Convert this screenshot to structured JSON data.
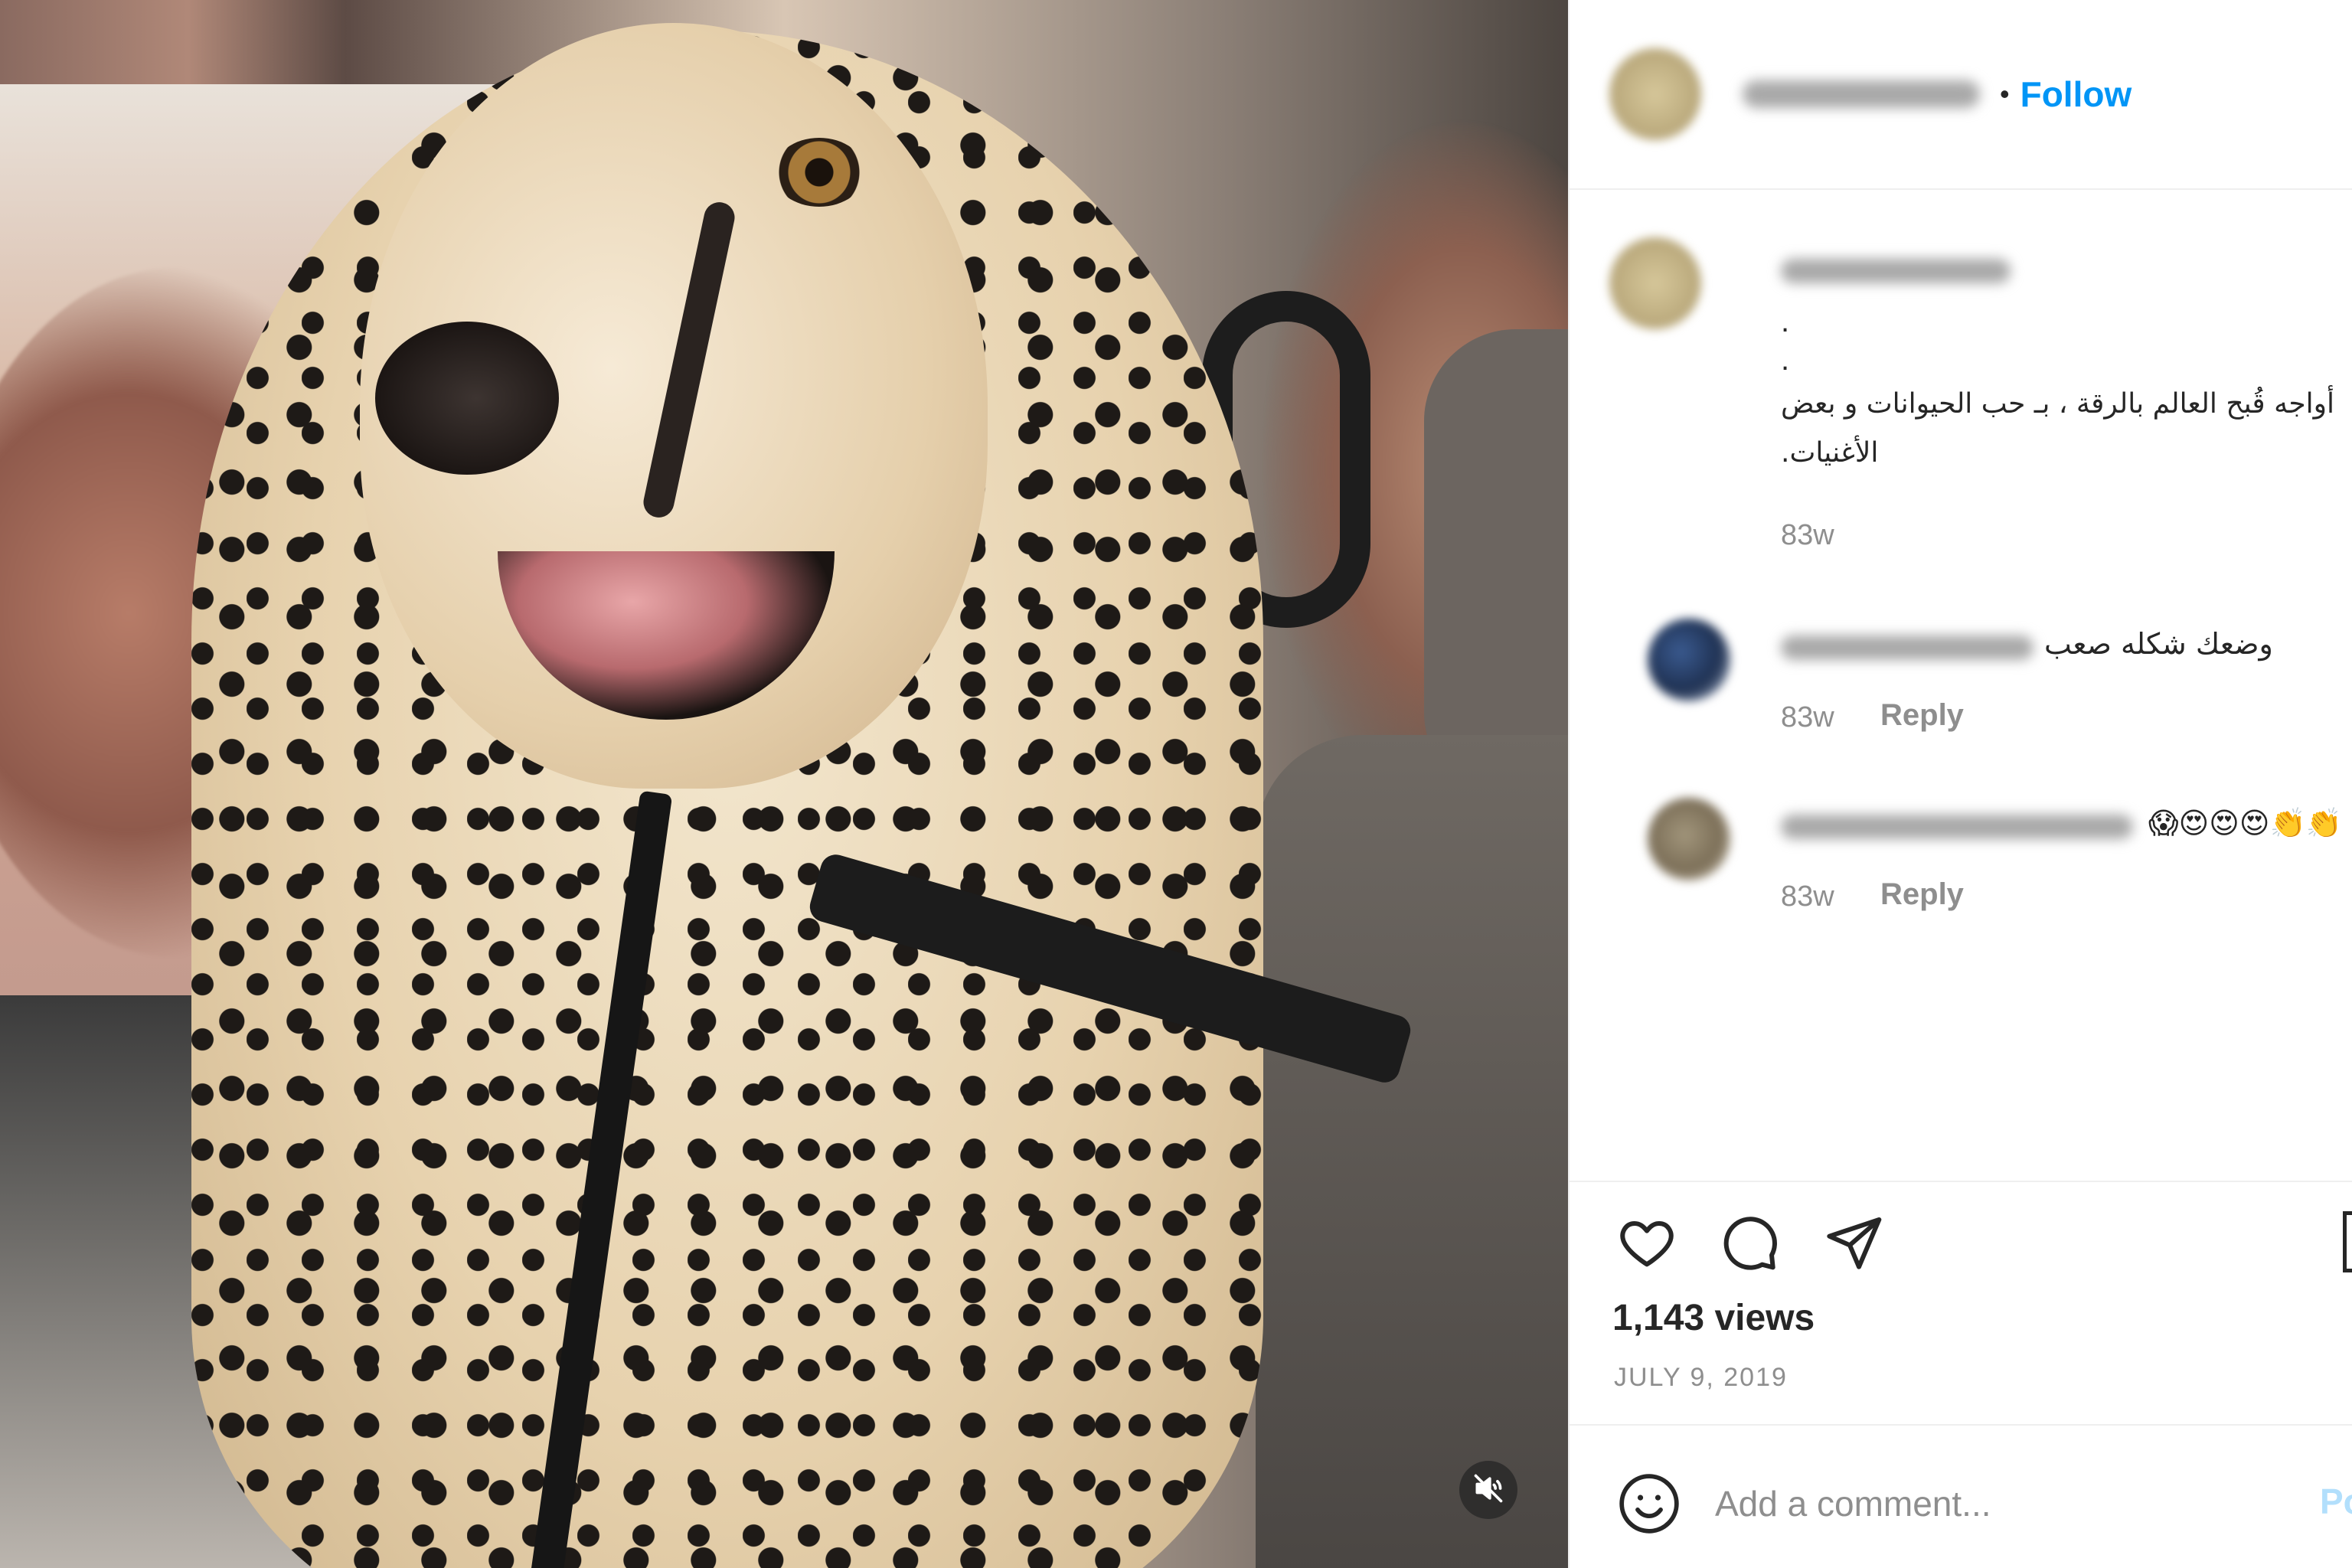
{
  "header": {
    "follow_label": "Follow",
    "separator": "•"
  },
  "caption": {
    "dot_1": ".",
    "dot_2": ".",
    "text": "أواجه قُبح العالم بالرقة ، بـ حب الحيوانات و بعض الأغنيات.",
    "time": "83w"
  },
  "comments": [
    {
      "text": "وضعك شكله صعب",
      "time": "83w",
      "reply_label": "Reply"
    },
    {
      "text": "😱😍😍😍👏👏",
      "time": "83w",
      "reply_label": "Reply"
    }
  ],
  "icons": {
    "like": "heart-icon",
    "comment": "comment-icon",
    "share": "paper-plane-icon",
    "save": "bookmark-icon",
    "emoji": "smiley-icon",
    "mute": "speaker-muted-icon"
  },
  "stats": {
    "views": "1,143 views",
    "date": "JULY 9, 2019"
  },
  "comment_box": {
    "placeholder": "Add a comment...",
    "post_label": "Post"
  },
  "colors": {
    "accent": "#0095f6",
    "post_disabled": "#b2dffc",
    "secondary_text": "#8e8e8e",
    "divider": "#efefef"
  }
}
